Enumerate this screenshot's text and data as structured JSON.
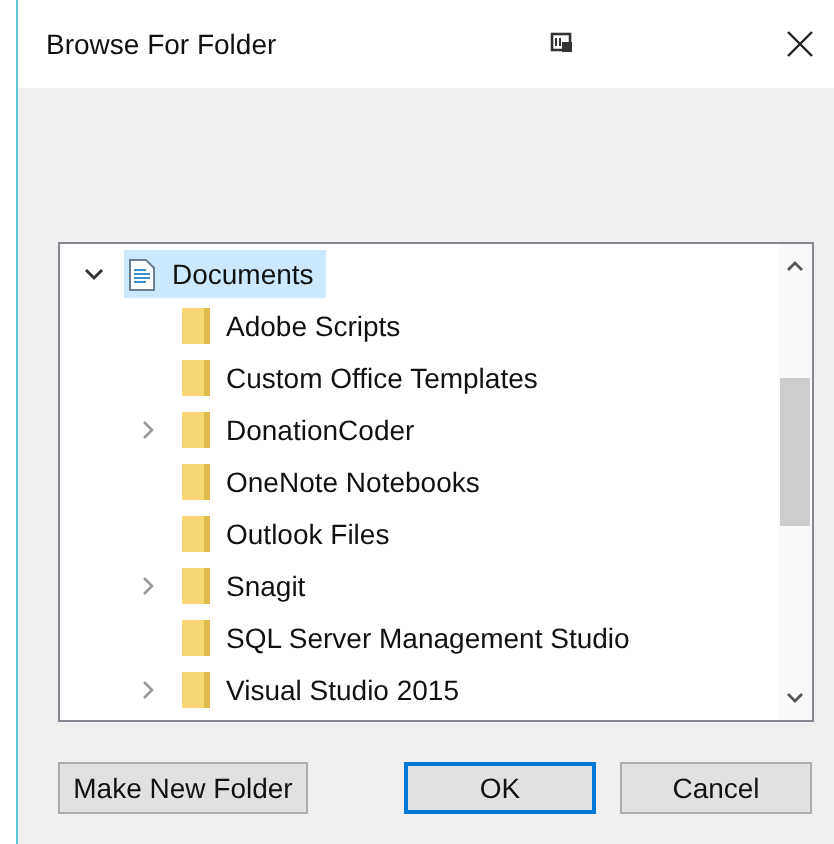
{
  "window": {
    "title": "Browse For Folder"
  },
  "tree": [
    {
      "label": "Documents",
      "kind": "documents",
      "selected": true,
      "expanded": true,
      "children": [
        {
          "label": "Adobe Scripts",
          "kind": "folder",
          "selected": false,
          "expandable": false
        },
        {
          "label": "Custom Office Templates",
          "kind": "folder",
          "selected": false,
          "expandable": false
        },
        {
          "label": "DonationCoder",
          "kind": "folder",
          "selected": false,
          "expandable": true
        },
        {
          "label": "OneNote Notebooks",
          "kind": "folder",
          "selected": false,
          "expandable": false
        },
        {
          "label": "Outlook Files",
          "kind": "folder",
          "selected": false,
          "expandable": false
        },
        {
          "label": "Snagit",
          "kind": "folder",
          "selected": false,
          "expandable": true
        },
        {
          "label": "SQL Server Management Studio",
          "kind": "folder",
          "selected": false,
          "expandable": false
        },
        {
          "label": "Visual Studio 2015",
          "kind": "folder",
          "selected": false,
          "expandable": true
        }
      ]
    }
  ],
  "buttons": [
    {
      "label": "Make New Folder",
      "default": false
    },
    {
      "label": "OK",
      "default": true
    },
    {
      "label": "Cancel",
      "default": false
    }
  ]
}
